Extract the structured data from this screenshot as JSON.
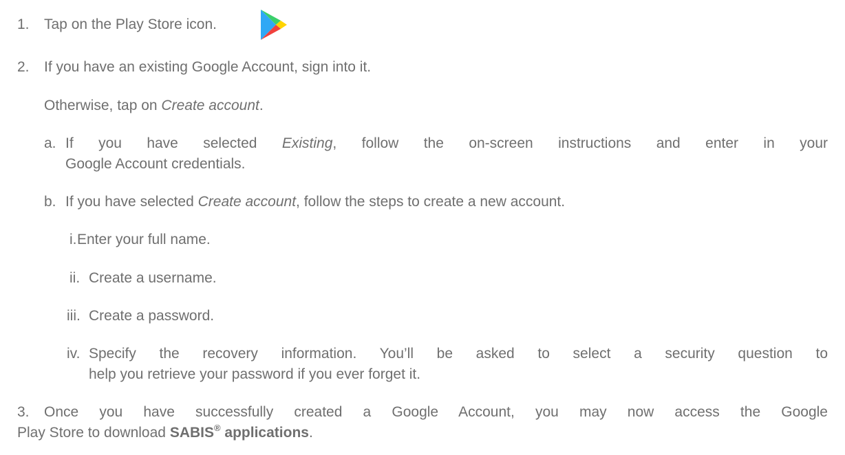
{
  "steps": {
    "s1": {
      "num": "1.",
      "text": "Tap on the Play Store icon."
    },
    "s2": {
      "num": "2.",
      "text": "If you have an existing Google Account, sign into it.",
      "otherwise_pre": "Otherwise, tap on ",
      "otherwise_em": "Create account",
      "otherwise_post": "."
    },
    "a": {
      "num": "a.",
      "l1_pre": "If you have selected ",
      "l1_em": "Existing",
      "l1_post": ", follow the on-screen instructions and enter in your",
      "l2": "Google Account credentials."
    },
    "b": {
      "num": "b.",
      "pre": "If you have selected ",
      "em": "Create account",
      "post": ", follow the steps to create a new account."
    },
    "i": {
      "num": "i.",
      "text": "Enter your full name."
    },
    "ii": {
      "num": "ii.",
      "text": "Create a username."
    },
    "iii": {
      "num": "iii.",
      "text": "Create a password."
    },
    "iv": {
      "num": "iv.",
      "l1": "Specify the recovery information. You’ll be asked to select a security question to",
      "l2": "help you retrieve your password if you ever forget it."
    },
    "s3": {
      "num": "3.",
      "l1": "Once you have successfully created a Google Account, you may now access the Google",
      "l2_pre": "Play Store to download ",
      "l2_bold": "SABIS",
      "l2_sup": "®",
      "l2_bold2": " applications",
      "l2_post": "."
    }
  },
  "icons": {
    "play_store": "play-store-icon",
    "colors": {
      "blue": "#2fa8f5",
      "green": "#3bcf6b",
      "yellow": "#ffd400",
      "red": "#f1413d"
    }
  }
}
